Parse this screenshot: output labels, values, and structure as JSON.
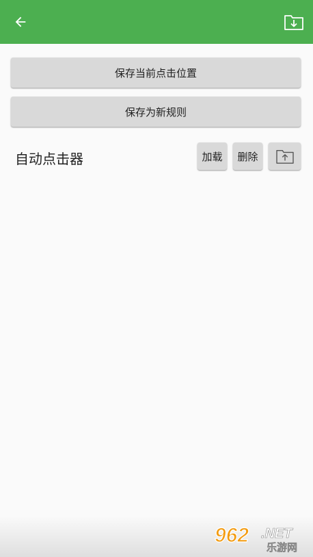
{
  "app_bar": {
    "back_icon": "arrow-left-icon",
    "import_icon": "folder-download-icon",
    "background_color": "#4caf50"
  },
  "actions": {
    "save_position_label": "保存当前点击位置",
    "save_rule_label": "保存为新规则"
  },
  "rule": {
    "name": "自动点击器",
    "load_label": "加载",
    "delete_label": "删除",
    "export_icon": "folder-upload-icon"
  },
  "watermark": {
    "brand": "962",
    "domain": ".NET",
    "subtitle": "乐游网"
  }
}
